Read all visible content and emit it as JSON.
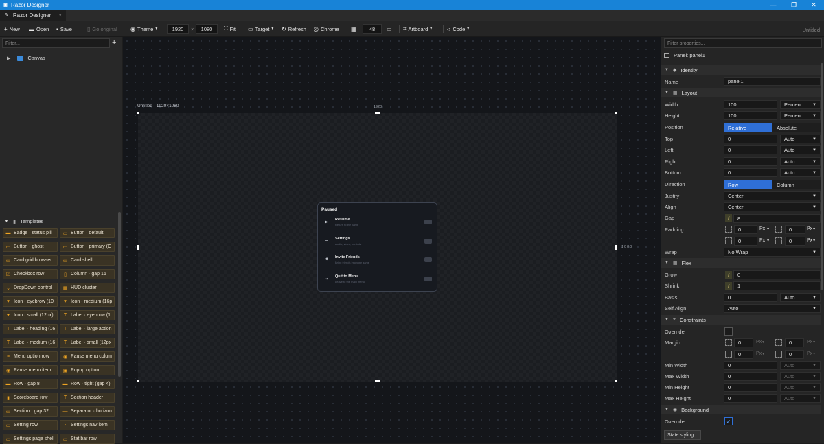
{
  "app": {
    "title": "Razor Designer",
    "tab": "Razor Designer",
    "document": "Untitled"
  },
  "window_controls": {
    "minimize": "—",
    "maximize": "❐",
    "close": "✕"
  },
  "toolbar": {
    "new": "New",
    "open": "Open",
    "save": "Save",
    "disabled_label": "Go original",
    "theme": "Theme",
    "width": "1920",
    "times": "×",
    "height": "1080",
    "fit": "Fit",
    "target": "Target",
    "refresh": "Refresh",
    "chrome": "Chrome",
    "grid": "48",
    "artboard": "Artboard",
    "code": "Code"
  },
  "left": {
    "filter_placeholder": "Filter...",
    "add": "+",
    "tree": [
      {
        "label": "Canvas"
      }
    ],
    "templates_header": "Templates",
    "templates": [
      {
        "label": "Badge · status pill",
        "icon": "badge-icon"
      },
      {
        "label": "Button · default",
        "icon": "button-icon"
      },
      {
        "label": "Button · ghost",
        "icon": "button-icon"
      },
      {
        "label": "Button · primary (C",
        "icon": "button-icon"
      },
      {
        "label": "Card grid browser",
        "icon": "card-icon"
      },
      {
        "label": "Card shell",
        "icon": "card-icon"
      },
      {
        "label": "Checkbox row",
        "icon": "checkbox-icon"
      },
      {
        "label": "Column · gap 16",
        "icon": "column-icon"
      },
      {
        "label": "DropDown control",
        "icon": "dropdown-icon"
      },
      {
        "label": "HUD cluster",
        "icon": "hud-icon"
      },
      {
        "label": "Icon · eyebrow (10",
        "icon": "heart-icon"
      },
      {
        "label": "Icon · medium (16p",
        "icon": "heart-icon"
      },
      {
        "label": "Icon · small (12px)",
        "icon": "heart-icon"
      },
      {
        "label": "Label · eyebrow (1",
        "icon": "text-icon"
      },
      {
        "label": "Label · heading (16",
        "icon": "text-icon"
      },
      {
        "label": "Label · large action",
        "icon": "text-icon"
      },
      {
        "label": "Label · medium (16",
        "icon": "text-icon"
      },
      {
        "label": "Label · small (12px",
        "icon": "text-icon"
      },
      {
        "label": "Menu option row",
        "icon": "menu-icon"
      },
      {
        "label": "Pause menu colum",
        "icon": "pause-icon"
      },
      {
        "label": "Pause menu item",
        "icon": "pause-icon"
      },
      {
        "label": "Popup option",
        "icon": "popup-icon"
      },
      {
        "label": "Row · gap 8",
        "icon": "row-icon"
      },
      {
        "label": "Row · tight (gap 4)",
        "icon": "row-icon"
      },
      {
        "label": "Scoreboard row",
        "icon": "chart-icon"
      },
      {
        "label": "Section header",
        "icon": "text-icon"
      },
      {
        "label": "Section · gap 32",
        "icon": "section-icon"
      },
      {
        "label": "Separator · horizon",
        "icon": "separator-icon"
      },
      {
        "label": "Setting row",
        "icon": "setting-icon"
      },
      {
        "label": "Settings nav item",
        "icon": "chevron-icon"
      },
      {
        "label": "Settings page shel",
        "icon": "page-icon"
      },
      {
        "label": "Stat bar row",
        "icon": "stat-icon"
      }
    ]
  },
  "canvas": {
    "artboard_label": "Untitled · 1920×1080",
    "width_label": "1920",
    "height_label": "1080",
    "pause_menu": {
      "title": "Paused",
      "items": [
        {
          "name": "Resume",
          "sub": "Return to the game",
          "icon": "play-icon"
        },
        {
          "name": "Settings",
          "sub": "Audio, video, controls",
          "icon": "settings-icon"
        },
        {
          "name": "Invite Friends",
          "sub": "Bring friends into your game",
          "icon": "users-icon"
        },
        {
          "name": "Quit to Menu",
          "sub": "Leave to the main menu",
          "icon": "exit-icon"
        }
      ]
    }
  },
  "right": {
    "filter_placeholder": "Filter properties...",
    "panel_title": "Panel: panel1",
    "identity": {
      "header": "Identity",
      "name_label": "Name",
      "name_value": "panel1"
    },
    "layout": {
      "header": "Layout",
      "width_label": "Width",
      "width_value": "100",
      "width_unit": "Percent",
      "height_label": "Height",
      "height_value": "100",
      "height_unit": "Percent",
      "position_label": "Position",
      "position_opt1": "Relative",
      "position_opt2": "Absolute",
      "top_label": "Top",
      "top_value": "0",
      "top_unit": "Auto",
      "left_label": "Left",
      "left_value": "0",
      "left_unit": "Auto",
      "right_label": "Right",
      "right_value": "0",
      "right_unit": "Auto",
      "bottom_label": "Bottom",
      "bottom_value": "0",
      "bottom_unit": "Auto",
      "direction_label": "Direction",
      "direction_opt1": "Row",
      "direction_opt2": "Column",
      "justify_label": "Justify",
      "justify_value": "Center",
      "align_label": "Align",
      "align_value": "Center",
      "gap_label": "Gap",
      "gap_value": "8",
      "padding_label": "Padding",
      "padding_values": [
        "0",
        "0",
        "0",
        "0"
      ],
      "padding_unit": "Px",
      "wrap_label": "Wrap",
      "wrap_value": "No Wrap"
    },
    "flex": {
      "header": "Flex",
      "grow_label": "Grow",
      "grow_value": "0",
      "shrink_label": "Shrink",
      "shrink_value": "1",
      "basis_label": "Basis",
      "basis_value": "0",
      "basis_unit": "Auto",
      "selfalign_label": "Self Align",
      "selfalign_value": "Auto"
    },
    "constraints": {
      "header": "Constraints",
      "override_label": "Override",
      "margin_label": "Margin",
      "margin_values": [
        "0",
        "0",
        "0",
        "0"
      ],
      "margin_unit": "Px",
      "minw_label": "Min Width",
      "minw_value": "0",
      "minw_unit": "Auto",
      "maxw_label": "Max Width",
      "maxw_value": "0",
      "maxw_unit": "Auto",
      "minh_label": "Min Height",
      "minh_value": "0",
      "minh_unit": "Auto",
      "maxh_label": "Max Height",
      "maxh_value": "0",
      "maxh_unit": "Auto"
    },
    "background": {
      "header": "Background",
      "override_label": "Override",
      "override_checked": true
    },
    "state_button": "State styling..."
  },
  "colors": {
    "accent": "#2f6fd6",
    "titlebar": "#1883d7",
    "template_icon": "#f0a623"
  }
}
